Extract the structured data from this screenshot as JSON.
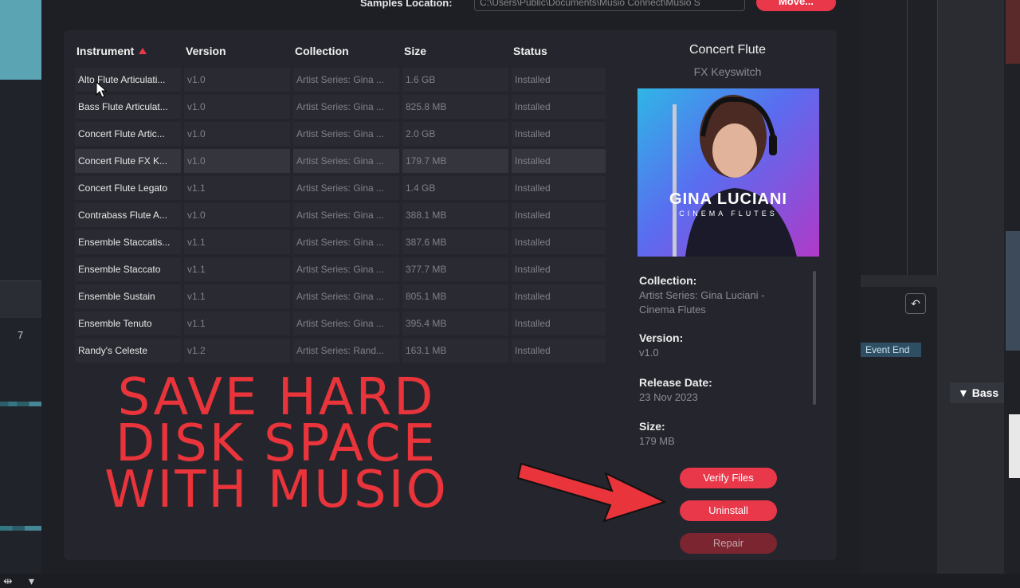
{
  "samples": {
    "label": "Samples Location:",
    "path": "C:\\Users\\Public\\Documents\\Musio Connect\\Musio S",
    "move_label": "Move..."
  },
  "table": {
    "columns": [
      "Instrument",
      "Version",
      "Collection",
      "Size",
      "Status"
    ],
    "sort_column": "Instrument",
    "rows": [
      {
        "instrument": "Alto Flute Articulati...",
        "version": "v1.0",
        "collection": "Artist Series: Gina ...",
        "size": "1.6 GB",
        "status": "Installed"
      },
      {
        "instrument": "Bass Flute Articulat...",
        "version": "v1.0",
        "collection": "Artist Series: Gina ...",
        "size": "825.8 MB",
        "status": "Installed"
      },
      {
        "instrument": "Concert Flute Artic...",
        "version": "v1.0",
        "collection": "Artist Series: Gina ...",
        "size": "2.0 GB",
        "status": "Installed"
      },
      {
        "instrument": "Concert Flute FX K...",
        "version": "v1.0",
        "collection": "Artist Series: Gina ...",
        "size": "179.7 MB",
        "status": "Installed"
      },
      {
        "instrument": "Concert Flute Legato",
        "version": "v1.1",
        "collection": "Artist Series: Gina ...",
        "size": "1.4 GB",
        "status": "Installed"
      },
      {
        "instrument": "Contrabass Flute A...",
        "version": "v1.0",
        "collection": "Artist Series: Gina ...",
        "size": "388.1 MB",
        "status": "Installed"
      },
      {
        "instrument": "Ensemble Staccatis...",
        "version": "v1.1",
        "collection": "Artist Series: Gina ...",
        "size": "387.6 MB",
        "status": "Installed"
      },
      {
        "instrument": "Ensemble Staccato",
        "version": "v1.1",
        "collection": "Artist Series: Gina ...",
        "size": "377.7 MB",
        "status": "Installed"
      },
      {
        "instrument": "Ensemble Sustain",
        "version": "v1.1",
        "collection": "Artist Series: Gina ...",
        "size": "805.1 MB",
        "status": "Installed"
      },
      {
        "instrument": "Ensemble Tenuto",
        "version": "v1.1",
        "collection": "Artist Series: Gina ...",
        "size": "395.4 MB",
        "status": "Installed"
      },
      {
        "instrument": "Randy's Celeste",
        "version": "v1.2",
        "collection": "Artist Series: Rand...",
        "size": "163.1 MB",
        "status": "Installed"
      }
    ],
    "selected_index": 3
  },
  "details": {
    "title": "Concert Flute",
    "subtitle": "FX Keyswitch",
    "cover_artist": "GINA LUCIANI",
    "cover_product": "CINEMA FLUTES",
    "collection_label": "Collection:",
    "collection_value": "Artist Series: Gina Luciani - Cinema Flutes",
    "version_label": "Version:",
    "version_value": "v1.0",
    "release_label": "Release Date:",
    "release_value": "23 Nov 2023",
    "size_label": "Size:",
    "size_value": "179 MB",
    "verify_label": "Verify Files",
    "uninstall_label": "Uninstall",
    "repair_label": "Repair"
  },
  "overlay": {
    "line1": "SAVE HARD",
    "line2": "DISK SPACE",
    "line3": "WITH MUSIO"
  },
  "background": {
    "ruler_number": "7",
    "event_end": "Event End",
    "track_name": "Bass"
  },
  "colors": {
    "accent": "#e8384a",
    "panel": "#25262d",
    "overlay_text": "#e8343a"
  }
}
